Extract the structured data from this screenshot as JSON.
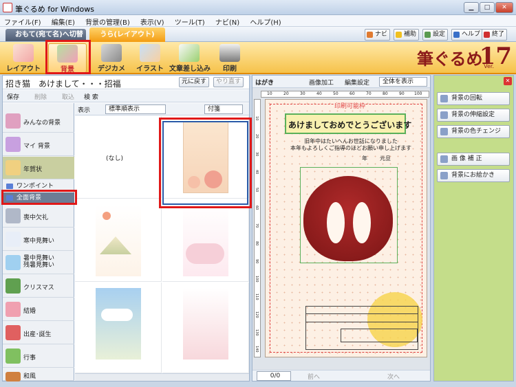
{
  "window": {
    "title": "筆ぐるめ for Windows",
    "min": "▁",
    "max": "□",
    "close": "✕"
  },
  "menu": [
    "ファイル(F)",
    "編集(E)",
    "背景の管理(B)",
    "表示(V)",
    "ツール(T)",
    "ナビ(N)",
    "ヘルプ(H)"
  ],
  "modes": {
    "omote": "おもて(宛て名)へ切替",
    "ura": "うら(レイアウト)"
  },
  "toolbar": {
    "navi": "ナビ",
    "hojo": "補助",
    "settei": "設定",
    "help": "ヘルプ",
    "exit": "終了"
  },
  "ribbon": [
    "レイアウト",
    "背景",
    "デジカメ",
    "イラスト",
    "文章差し込み",
    "印刷"
  ],
  "logo": {
    "text": "筆ぐるめ",
    "version": "17",
    "ver_label": "Ver."
  },
  "left": {
    "title": "招き猫　あけまして・・・招福",
    "undo": "元に戻す",
    "redo": "やり直す",
    "save": "保存",
    "delete": "削除",
    "import": "取込",
    "search": "検 索",
    "view_label": "表示",
    "sort": "標準順表示",
    "attach": "付箋"
  },
  "categories": [
    {
      "label": "みんなの背景"
    },
    {
      "label": "マイ 背景"
    },
    {
      "label": "年賀状"
    },
    {
      "label": "ワンポイント"
    },
    {
      "label": "全面背景"
    },
    {
      "label": "喪中欠礼"
    },
    {
      "label": "寒中見舞い"
    },
    {
      "label": "暑中見舞い",
      "label2": "残暑見舞い"
    },
    {
      "label": "クリスマス"
    },
    {
      "label": "結婚"
    },
    {
      "label": "出産･誕生"
    },
    {
      "label": "行事"
    },
    {
      "label": "和風"
    }
  ],
  "grid": {
    "none_label": "(なし)"
  },
  "canvas": {
    "label": "はがき",
    "edit_image": "画像加工",
    "edit_settings": "編集設定",
    "zoom": "全体を表示",
    "print_area": "印刷可能枠",
    "greeting_title": "あけましておめでとうございます",
    "greeting_line1": "旧年中はたいへんお世話になりました",
    "greeting_line2": "本年もよろしくご指導のほどお願い申し上げます",
    "date_nen": "年",
    "date_gantan": "元旦",
    "page_counter": "0/0",
    "prev": "前へ",
    "next": "次へ",
    "ruler_ticks": [
      "10",
      "20",
      "30",
      "40",
      "50",
      "60",
      "70",
      "80",
      "90",
      "100"
    ],
    "vruler_ticks": [
      "10",
      "20",
      "30",
      "40",
      "50",
      "60",
      "70",
      "80",
      "90",
      "100",
      "110",
      "120",
      "130",
      "140"
    ]
  },
  "right": {
    "buttons": [
      "背景の回転",
      "背景の伸縮設定",
      "背景の色チェンジ",
      "画 像 補 正",
      "背景にお絵かき"
    ]
  },
  "colors": {
    "accent": "#f39c12",
    "highlight": "#e01818",
    "select_border": "#2a5aa8"
  }
}
